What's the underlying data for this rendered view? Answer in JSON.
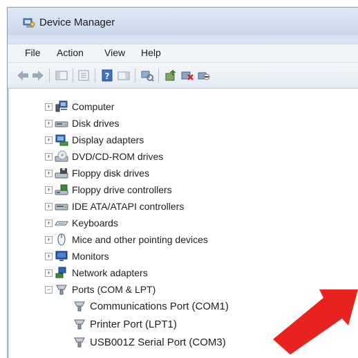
{
  "window": {
    "title": "Device Manager"
  },
  "menu": [
    {
      "label": "File"
    },
    {
      "label": "Action"
    },
    {
      "label": "View"
    },
    {
      "label": "Help"
    }
  ],
  "toolbar": {
    "buttons": [
      "back-icon",
      "forward-icon",
      "show-hide-console-tree-icon",
      "properties-icon",
      "help-icon",
      "action-pane-icon",
      "scan-hardware-icon",
      "update-driver-icon",
      "uninstall-icon",
      "disable-icon"
    ]
  },
  "tree": {
    "categories": [
      {
        "label": "Computer",
        "icon": "computer-icon",
        "expanded": false
      },
      {
        "label": "Disk drives",
        "icon": "disk-drive-icon",
        "expanded": false
      },
      {
        "label": "Display adapters",
        "icon": "display-adapter-icon",
        "expanded": false
      },
      {
        "label": "DVD/CD-ROM drives",
        "icon": "dvd-drive-icon",
        "expanded": false
      },
      {
        "label": "Floppy disk drives",
        "icon": "floppy-disk-icon",
        "expanded": false
      },
      {
        "label": "Floppy drive controllers",
        "icon": "floppy-controller-icon",
        "expanded": false
      },
      {
        "label": "IDE ATA/ATAPI controllers",
        "icon": "ide-controller-icon",
        "expanded": false
      },
      {
        "label": "Keyboards",
        "icon": "keyboard-icon",
        "expanded": false
      },
      {
        "label": "Mice and other pointing devices",
        "icon": "mouse-icon",
        "expanded": false
      },
      {
        "label": "Monitors",
        "icon": "monitor-icon",
        "expanded": false
      },
      {
        "label": "Network adapters",
        "icon": "network-adapter-icon",
        "expanded": false
      },
      {
        "label": "Ports (COM & LPT)",
        "icon": "port-icon",
        "expanded": true
      }
    ],
    "ports_children": [
      {
        "label": "Communications Port (COM1)",
        "icon": "port-icon"
      },
      {
        "label": "Printer Port (LPT1)",
        "icon": "port-icon"
      },
      {
        "label": "USB001Z Serial Port (COM3)",
        "icon": "port-icon"
      }
    ]
  },
  "colors": {
    "arrow": "#e8231f",
    "window_frame": "#d9e4f1"
  }
}
